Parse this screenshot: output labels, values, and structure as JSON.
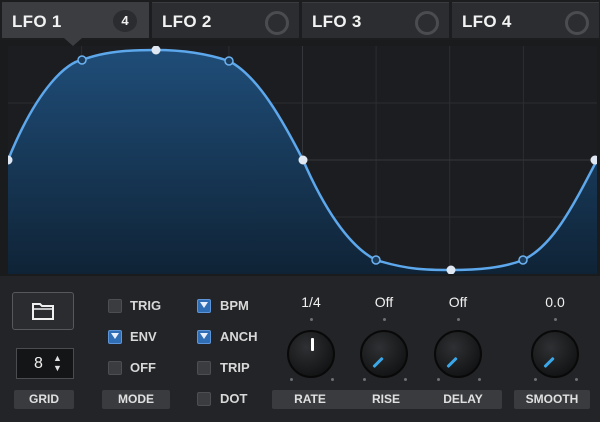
{
  "tabs": [
    {
      "label": "LFO 1",
      "badge": "4",
      "active": true
    },
    {
      "label": "LFO 2",
      "active": false
    },
    {
      "label": "LFO 3",
      "active": false
    },
    {
      "label": "LFO 4",
      "active": false
    }
  ],
  "grid": {
    "value": "8",
    "label": "GRID"
  },
  "mode": {
    "label": "MODE",
    "options": [
      {
        "label": "TRIG",
        "checked": false
      },
      {
        "label": "ENV",
        "checked": true
      },
      {
        "label": "OFF",
        "checked": false
      }
    ]
  },
  "timing": {
    "options": [
      {
        "label": "BPM",
        "checked": true
      },
      {
        "label": "ANCH",
        "checked": true
      },
      {
        "label": "TRIP",
        "checked": false
      },
      {
        "label": "DOT",
        "checked": false
      }
    ]
  },
  "knobs": [
    {
      "label": "RATE",
      "value": "1/4"
    },
    {
      "label": "RISE",
      "value": "Off"
    },
    {
      "label": "DELAY",
      "value": "Off"
    },
    {
      "label": "SMOOTH",
      "value": "0.0"
    }
  ],
  "colors": {
    "accent": "#3a8fd6",
    "curve": "#5da8ec",
    "fill_top": "#1e4a72",
    "background": "#1a1b1d"
  }
}
